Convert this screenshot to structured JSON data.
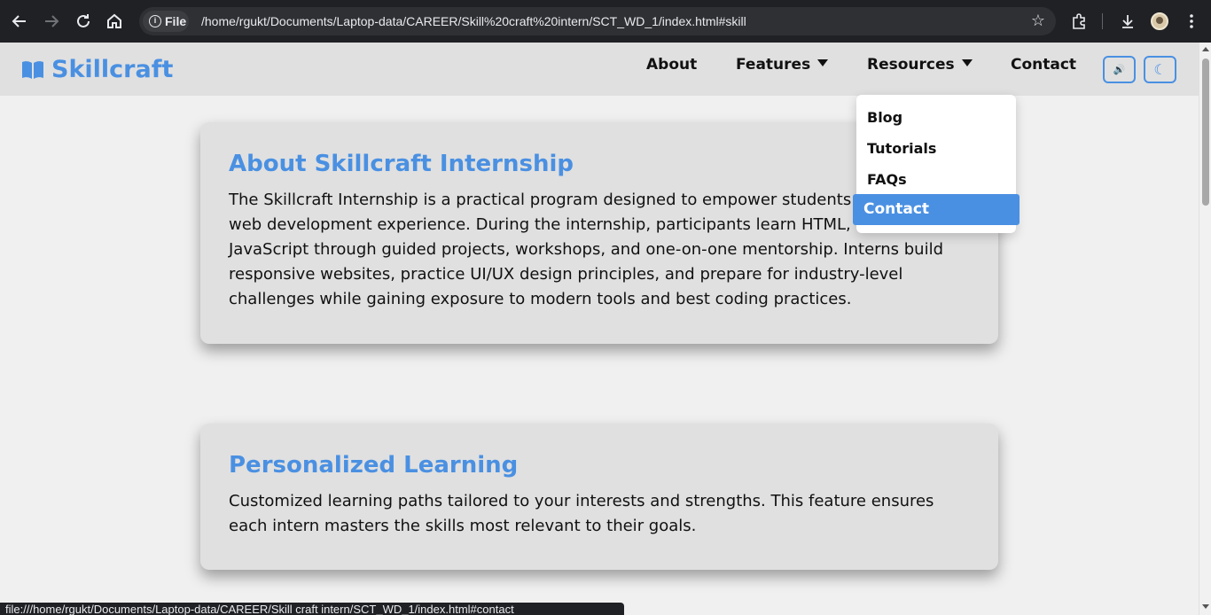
{
  "browser": {
    "url": "/home/rgukt/Documents/Laptop-data/CAREER/Skill%20craft%20intern/SCT_WD_1/index.html#skill",
    "site_chip_label": "File",
    "status_url": "file:///home/rgukt/Documents/Laptop-data/CAREER/Skill craft intern/SCT_WD_1/index.html#contact",
    "icons": [
      "back-icon",
      "forward-icon",
      "reload-icon",
      "home-icon",
      "info-icon",
      "star-icon",
      "extensions-icon",
      "download-icon",
      "profile-avatar",
      "menu-icon"
    ]
  },
  "site": {
    "logo_text": "Skillcraft",
    "accent_color": "#4a90e2",
    "nav": {
      "about": "About",
      "features": "Features",
      "resources": "Resources",
      "contact": "Contact"
    },
    "buttons": {
      "sound_icon": "🔊",
      "theme_icon": "☾"
    },
    "resources_dropdown": {
      "items": [
        "Blog",
        "Tutorials",
        "FAQs",
        "Contact"
      ],
      "highlighted": "Contact"
    }
  },
  "sections": [
    {
      "title": "About Skillcraft Internship",
      "body": "The Skillcraft Internship is a practical program designed to empower students with hands-on web development experience. During the internship, participants learn HTML, CSS, and JavaScript through guided projects, workshops, and one-on-one mentorship. Interns build responsive websites, practice UI/UX design principles, and prepare for industry-level challenges while gaining exposure to modern tools and best coding practices."
    },
    {
      "title": "Personalized Learning",
      "body": "Customized learning paths tailored to your interests and strengths. This feature ensures each intern masters the skills most relevant to their goals."
    }
  ]
}
